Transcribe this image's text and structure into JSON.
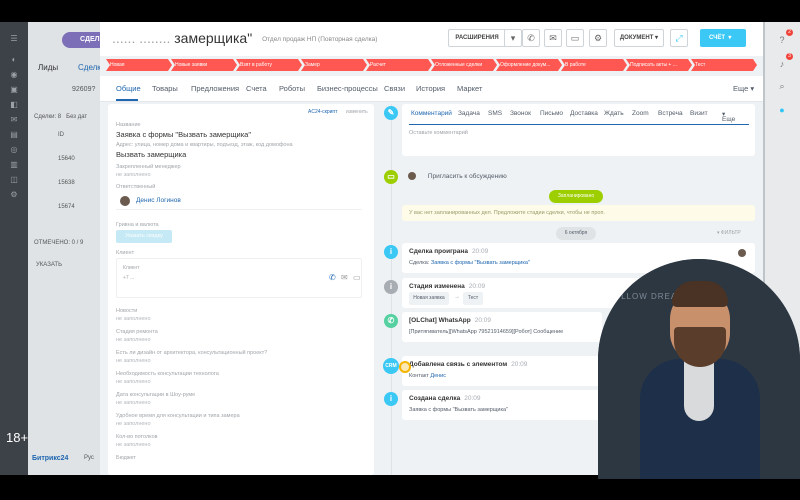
{
  "bg": {
    "deal_btn": "СДЕЛКА",
    "tabs": [
      "Лиды",
      "Сделк"
    ],
    "search_value": "92609?",
    "list_rows": [
      {
        "left": "Сделки: 8",
        "right": "Без дат"
      },
      {
        "left": "ID",
        "right": ""
      },
      {
        "left": "15640",
        "right": ""
      },
      {
        "left": "15638",
        "right": ""
      },
      {
        "left": "15674",
        "right": ""
      }
    ],
    "selected": "ОТМЕЧЕНО: 0 / 9",
    "apply": "УКАЗАТЬ",
    "logo": "Битрикс24",
    "lang": "Рус"
  },
  "header": {
    "title_dim": "...... ........",
    "title": "замерщика\"",
    "title_sub": "Отдел продаж НП (Повторная сделка)",
    "ext_label": "РАСШИРЕНИЯ",
    "doc_label": "ДОКУМЕНТ",
    "account_label": "СЧЁТ"
  },
  "stages": [
    "Новая",
    "Новые заявки",
    "Взят в работу",
    "Замер",
    "Расчет",
    "Отложенные сделки",
    "Оформление докум...",
    "В работе",
    "Подписать акты + ...",
    "Тест"
  ],
  "tabs": [
    "Общие",
    "Товары",
    "Предложения",
    "Счета",
    "Роботы",
    "Бизнес-процессы",
    "Связи",
    "История",
    "Маркет"
  ],
  "tabs_more": "Еще",
  "left": {
    "top_link1": "AC24-скрипт",
    "top_link2": "изменить",
    "name_label": "Название",
    "name_value": "Заявка с формы \"Вызвать замерщика\"",
    "name_hint": "Адрес: улица, номер дома и квартиры, подъезд, этаж, код домофона",
    "name_value2": "Вызвать замерщика",
    "manager_label": "Закрепленный менеджер",
    "not_filled": "не заполнено",
    "resp_label": "Ответственный",
    "resp_name": "Денис Логинов",
    "goods_label": "Гривна и валюта",
    "goods_btn": "Указать скидку",
    "client_label": "Клиент",
    "client_phone_hint": "+7 ...",
    "fields": [
      {
        "label": "Новости",
        "value": "не заполнено"
      },
      {
        "label": "Стадия ремонта",
        "value": "не заполнено"
      },
      {
        "label": "Есть ли дизайн от архитектора, консультационный проект?",
        "value": "не заполнено"
      },
      {
        "label": "Необходимость консультации технолога",
        "value": "не заполнено"
      },
      {
        "label": "Дата консультации в Шоу-руме",
        "value": "не заполнено"
      },
      {
        "label": "Удобное время для консультации и типа замера",
        "value": "не заполнено"
      },
      {
        "label": "Кол-во потолков",
        "value": "не заполнено"
      },
      {
        "label": "Бюджет",
        "value": ""
      }
    ]
  },
  "timeline": {
    "tabs": [
      "Комментарий",
      "Задача",
      "SMS",
      "Звонок",
      "Письмо",
      "Доставка",
      "Ждать",
      "Zoom",
      "Встреча",
      "Визит"
    ],
    "tabs_more": "Еще",
    "comment_placeholder": "Оставьте комментарий",
    "invite": "Пригласить к обсуждению",
    "planned_badge": "Запланировано",
    "planned_text": "У вас нет запланированных дел. Предложите стадии сделки, чтобы не проп.",
    "date_badge": "6 октября",
    "filter": "ФИЛЬТР",
    "items": [
      {
        "title": "Сделка проиграна",
        "time": "20:09",
        "text": "Сделка:",
        "link": "Заявка с формы \"Вызвать замерщика\""
      },
      {
        "title": "Стадия изменена",
        "time": "20:09",
        "from": "Новая заявка",
        "to": "Тест"
      },
      {
        "title": "[OLChat] WhatsApp",
        "time": "20:09",
        "text": "[Притягиватель][WhatsApp 79521914659][Робот] Сообщение"
      },
      {
        "title": "Добавлена связь с элементом",
        "time": "20:09",
        "text": "Контакт",
        "link": "Денис"
      },
      {
        "title": "Создана сделка",
        "time": "20:09",
        "text": "Заявка с формы \"Вызвать замерщика\""
      }
    ]
  },
  "webcam": {
    "backdrop_text": "FOLLOW DREAM"
  },
  "overlay": {
    "age": "18+"
  },
  "colors": {
    "stage": "#ff5752",
    "accent": "#2067b0",
    "account": "#3bc8f5",
    "timeline_blue": "#3bc8f5",
    "whatsapp": "#55d0a0"
  }
}
